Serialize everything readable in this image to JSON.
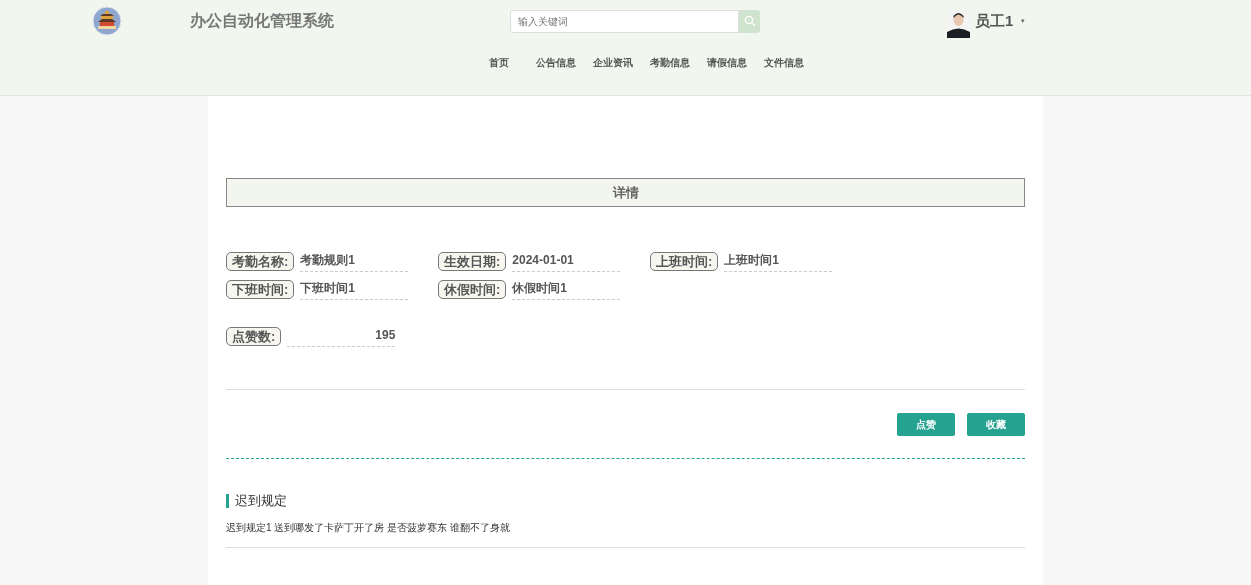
{
  "header": {
    "title": "办公自动化管理系统",
    "search": {
      "placeholder": "输入关键词"
    },
    "user": {
      "name": "员工1",
      "caret": "▾"
    }
  },
  "nav": [
    {
      "label": "首页",
      "selected": false
    },
    {
      "label": "公告信息",
      "selected": false
    },
    {
      "label": "企业资讯",
      "selected": false
    },
    {
      "label": "考勤信息",
      "selected": false
    },
    {
      "label": "请假信息",
      "selected": false
    },
    {
      "label": "文件信息",
      "selected": false
    }
  ],
  "detail": {
    "title": "详情",
    "rows": [
      [
        {
          "label": "考勤名称:",
          "value": "考勤规则1"
        },
        {
          "label": "生效日期:",
          "value": "2024-01-01"
        },
        {
          "label": "上班时间:",
          "value": "上班时间1"
        }
      ],
      [
        {
          "label": "下班时间:",
          "value": "下班时间1"
        },
        {
          "label": "休假时间:",
          "value": "休假时间1"
        }
      ]
    ],
    "likes": {
      "label": "点赞数:",
      "value": "195"
    },
    "buttons": [
      "点赞",
      "收藏"
    ]
  },
  "section": {
    "title": "迟到规定",
    "text": "迟到规定1 送到哪发了卡萨丁开了房 是否菠萝赛东 谁翻不了身就"
  }
}
